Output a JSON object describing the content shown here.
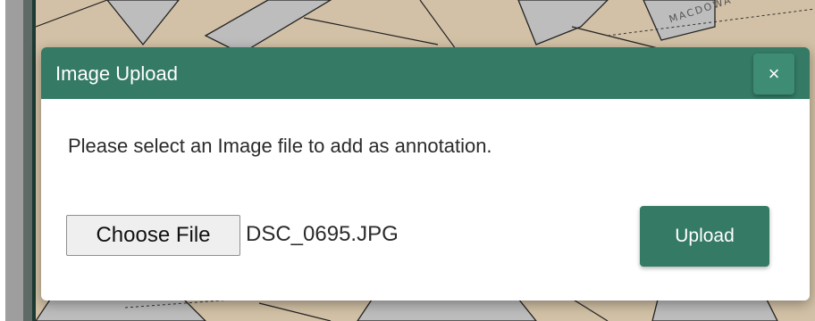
{
  "background": {
    "map_label": "MACDOWA"
  },
  "modal": {
    "title": "Image Upload",
    "close_label": "×",
    "message": "Please select an Image file to add as annotation.",
    "choose_file_label": "Choose File",
    "file_name": "DSC_0695.JPG",
    "upload_label": "Upload"
  },
  "colors": {
    "header": "#347a65",
    "upload_button": "#347a65",
    "map_parcel": "#d2c1a6"
  }
}
